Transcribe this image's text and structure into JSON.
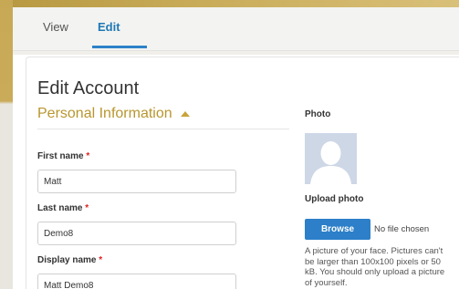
{
  "tabs": {
    "view_label": "View",
    "edit_label": "Edit",
    "active": "Edit"
  },
  "page": {
    "title": "Edit Account",
    "section_title": "Personal Information"
  },
  "form": {
    "required_marker": "*",
    "first_name": {
      "label": "First name",
      "value": "Matt"
    },
    "last_name": {
      "label": "Last name",
      "value": "Demo8"
    },
    "display_name": {
      "label": "Display name",
      "value": "Matt Demo8"
    }
  },
  "photo": {
    "label": "Photo",
    "upload_label": "Upload photo",
    "browse_label": "Browse",
    "no_file_text": "No file chosen",
    "help_text": "A picture of your face. Pictures can't be larger than 100x100 pixels or 50 kB. You should only upload a picture of yourself."
  },
  "colors": {
    "accent_blue": "#2c7fc8",
    "section_gold": "#b8962e",
    "required_red": "#dd2222"
  },
  "icons": {
    "section_toggle": "triangle-up-icon",
    "avatar": "default-avatar-silhouette"
  }
}
